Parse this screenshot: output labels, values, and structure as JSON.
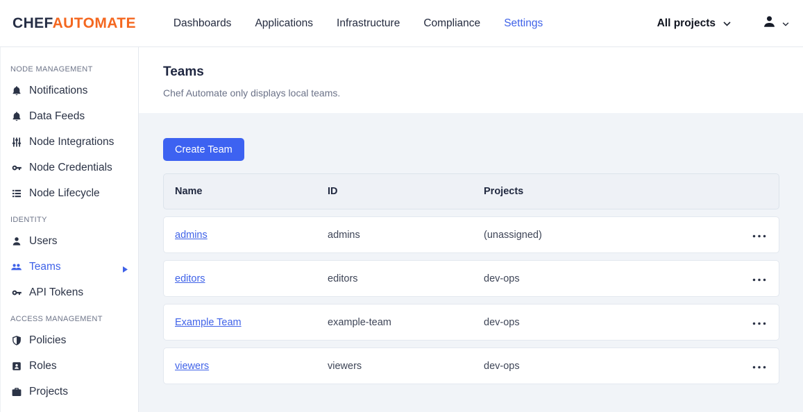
{
  "header": {
    "logo": {
      "chef": "CHEF",
      "automate": "AUTOMATE"
    },
    "nav": [
      {
        "label": "Dashboards"
      },
      {
        "label": "Applications"
      },
      {
        "label": "Infrastructure"
      },
      {
        "label": "Compliance"
      },
      {
        "label": "Settings",
        "active": true
      }
    ],
    "projects_dropdown": {
      "label": "All projects",
      "icon": "chevron-down-icon"
    },
    "user_menu": {
      "icon": "user-avatar-icon",
      "chevron": "chevron-down-icon"
    }
  },
  "sidebar": {
    "sections": [
      {
        "label": "NODE MANAGEMENT",
        "items": [
          {
            "icon": "bell-icon",
            "label": "Notifications"
          },
          {
            "icon": "bell-icon",
            "label": "Data Feeds"
          },
          {
            "icon": "sliders-icon",
            "label": "Node Integrations"
          },
          {
            "icon": "key-icon",
            "label": "Node Credentials"
          },
          {
            "icon": "list-icon",
            "label": "Node Lifecycle"
          }
        ]
      },
      {
        "label": "IDENTITY",
        "items": [
          {
            "icon": "user-icon",
            "label": "Users"
          },
          {
            "icon": "group-icon",
            "label": "Teams",
            "active": true
          },
          {
            "icon": "key-icon",
            "label": "API Tokens"
          }
        ]
      },
      {
        "label": "ACCESS MANAGEMENT",
        "items": [
          {
            "icon": "shield-icon",
            "label": "Policies"
          },
          {
            "icon": "badge-icon",
            "label": "Roles"
          },
          {
            "icon": "briefcase-icon",
            "label": "Projects"
          }
        ]
      }
    ]
  },
  "main": {
    "title": "Teams",
    "subtitle": "Chef Automate only displays local teams.",
    "create_team_button": "Create Team",
    "table": {
      "columns": [
        "Name",
        "ID",
        "Projects"
      ],
      "rows": [
        {
          "name": "admins",
          "id": "admins",
          "projects": "(unassigned)"
        },
        {
          "name": "editors",
          "id": "editors",
          "projects": "dev-ops"
        },
        {
          "name": "Example Team",
          "id": "example-team",
          "projects": "dev-ops"
        },
        {
          "name": "viewers",
          "id": "viewers",
          "projects": "dev-ops"
        }
      ]
    }
  },
  "colors": {
    "brand_navy": "#262e45",
    "brand_orange": "#f4671f",
    "accent_blue": "#3f62e8",
    "page_bg": "#f1f4f8"
  }
}
